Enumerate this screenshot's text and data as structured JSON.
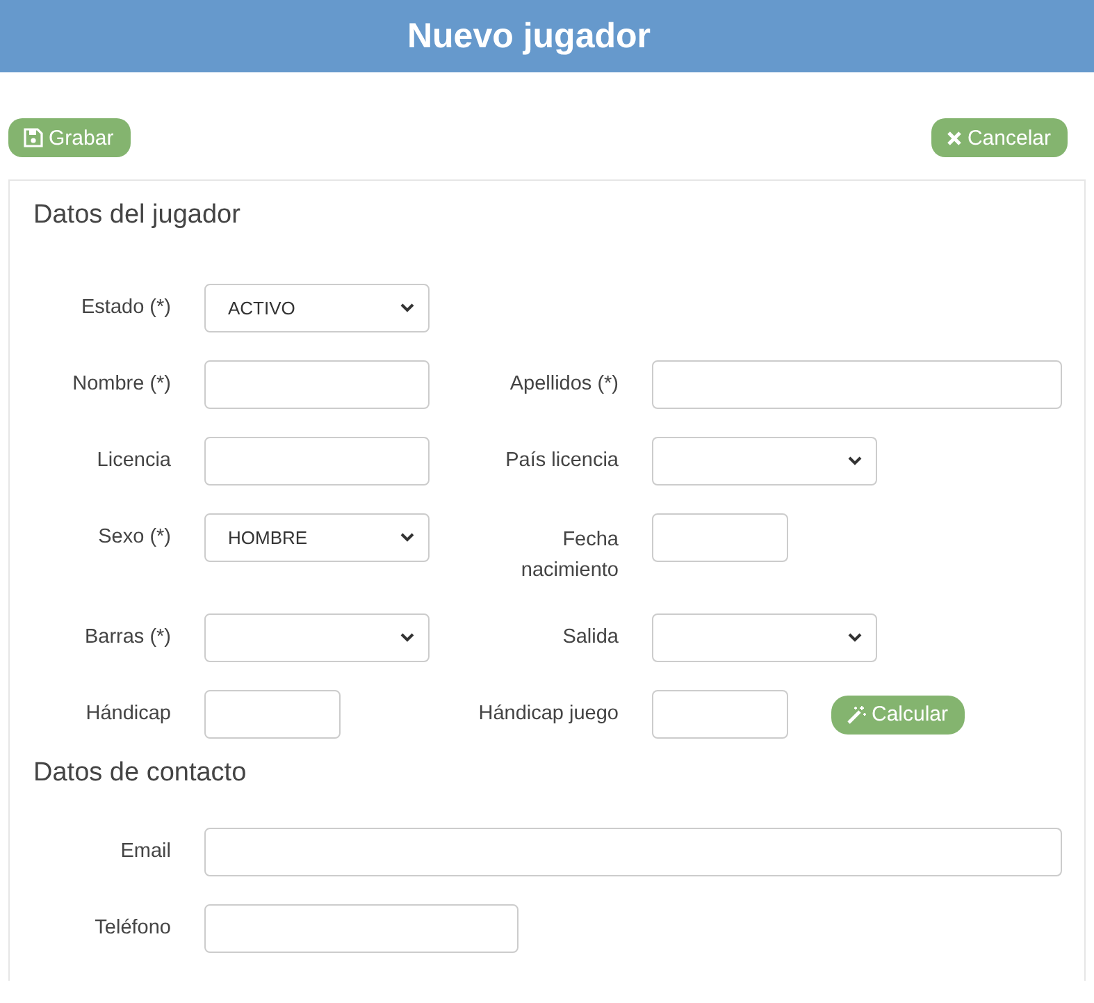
{
  "window": {
    "title": "Nuevo jugador"
  },
  "toolbar": {
    "save": "Grabar",
    "cancel": "Cancelar"
  },
  "sections": [
    {
      "heading": "Datos del jugador",
      "rows": [
        [
          {
            "label": "Estado (*)",
            "kind": "select",
            "value": "ACTIVO"
          }
        ],
        [
          {
            "label": "Nombre (*)",
            "kind": "text"
          },
          {
            "label": "Apellidos (*)",
            "kind": "text"
          }
        ],
        [
          {
            "label": "Licencia",
            "kind": "text"
          },
          {
            "label": "País licencia",
            "kind": "select"
          }
        ],
        [
          {
            "label": "Sexo (*)",
            "kind": "select",
            "value": "HOMBRE"
          },
          {
            "label": "Fecha nacimiento",
            "kind": "date"
          }
        ],
        [
          {
            "label": "Barras (*)",
            "kind": "select"
          },
          {
            "label": "Salida",
            "kind": "select"
          }
        ],
        [
          {
            "label": "Hándicap",
            "kind": "number"
          },
          {
            "label": "Hándicap juego",
            "kind": "number",
            "action": "Calcular"
          }
        ]
      ]
    },
    {
      "heading": "Datos de contacto",
      "rows": [
        [
          {
            "label": "Email",
            "kind": "email"
          }
        ],
        [
          {
            "label": "Teléfono",
            "kind": "tel"
          }
        ]
      ]
    }
  ]
}
